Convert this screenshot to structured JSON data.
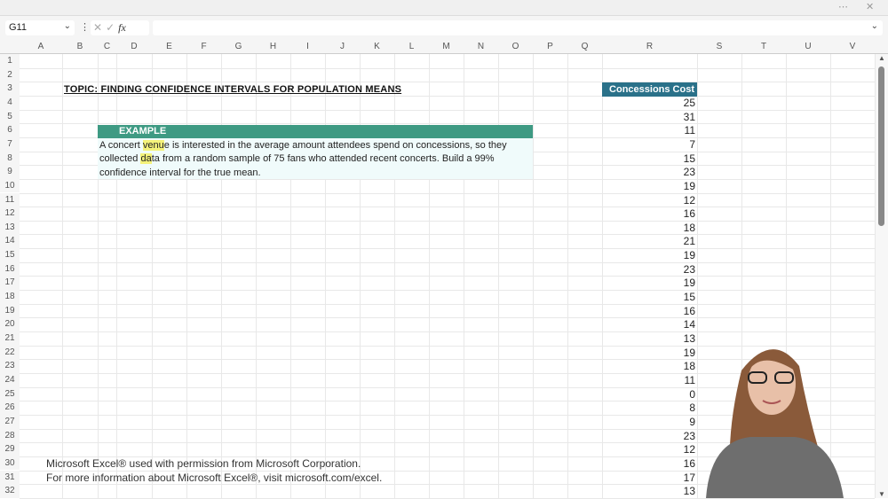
{
  "window": {
    "more_icon": "⋯",
    "close_icon": "✕"
  },
  "formula_bar": {
    "name_box": "G11",
    "formula": ""
  },
  "columns": [
    "A",
    "B",
    "C",
    "D",
    "E",
    "F",
    "G",
    "H",
    "I",
    "J",
    "K",
    "L",
    "M",
    "N",
    "O",
    "P",
    "Q",
    "R",
    "S",
    "T",
    "U",
    "V"
  ],
  "rows": [
    "1",
    "2",
    "3",
    "4",
    "5",
    "6",
    "7",
    "8",
    "9",
    "10",
    "11",
    "12",
    "13",
    "14",
    "15",
    "16",
    "17",
    "18",
    "19",
    "20",
    "21",
    "22",
    "23",
    "24",
    "25",
    "26",
    "27",
    "28",
    "29",
    "30",
    "31",
    "32"
  ],
  "sheet": {
    "title": "TOPIC: FINDING CONFIDENCE INTERVALS FOR POPULATION MEANS",
    "example_header": "EXAMPLE",
    "example_pre": "A concert ",
    "example_hl1": "venu",
    "example_mid1": "e is interested in the average amount attendees spend on concessions, so they",
    "example_line2a": "collected ",
    "example_hl2": "da",
    "example_line2b": "ta from a random sample of 75 fans who attended recent concerts. Build a 99%",
    "example_line3": "confidence interval for the true mean.",
    "data_header": "Concessions Cost",
    "values": [
      "25",
      "31",
      "11",
      "7",
      "15",
      "23",
      "19",
      "12",
      "16",
      "18",
      "21",
      "19",
      "23",
      "19",
      "15",
      "16",
      "14",
      "13",
      "19",
      "18",
      "11",
      "0",
      "8",
      "9",
      "23",
      "12",
      "16",
      "17",
      "13"
    ]
  },
  "credits": {
    "line1": "Microsoft Excel® used with permission from Microsoft Corporation.",
    "line2": "For more information about Microsoft Excel®, visit microsoft.com/excel."
  },
  "colors": {
    "example_header": "#3e9a83",
    "data_header": "#2a7189"
  }
}
